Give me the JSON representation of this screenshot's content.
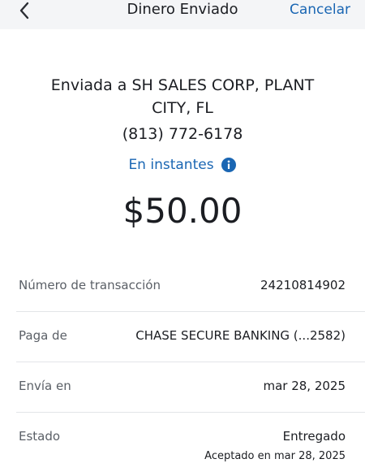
{
  "header": {
    "title": "Dinero Enviado",
    "cancel_label": "Cancelar",
    "back_icon": "chevron-left-icon"
  },
  "recipient": {
    "line": "Enviada a SH SALES CORP, PLANT CITY, FL",
    "prefix": "Enviada a ",
    "name": "SH SALES CORP, PLANT CITY, FL",
    "phone": "(813) 772-6178"
  },
  "speed": {
    "label": "En instantes",
    "icon": "info-icon"
  },
  "amount": "$50.00",
  "details": [
    {
      "label": "Número de transacción",
      "value": "24210814902"
    },
    {
      "label": "Paga de",
      "value": "CHASE SECURE BANKING (...2582)"
    },
    {
      "label": "Envía en",
      "value": "mar 28, 2025"
    },
    {
      "label": "Estado",
      "value": "Entregado",
      "subvalue": "Aceptado en mar 28, 2025"
    }
  ],
  "colors": {
    "accent": "#1a66b3",
    "header_bg": "#f4f5f7",
    "text": "#1b1d22",
    "muted": "#5a5f66",
    "divider": "#e3e5e8"
  }
}
